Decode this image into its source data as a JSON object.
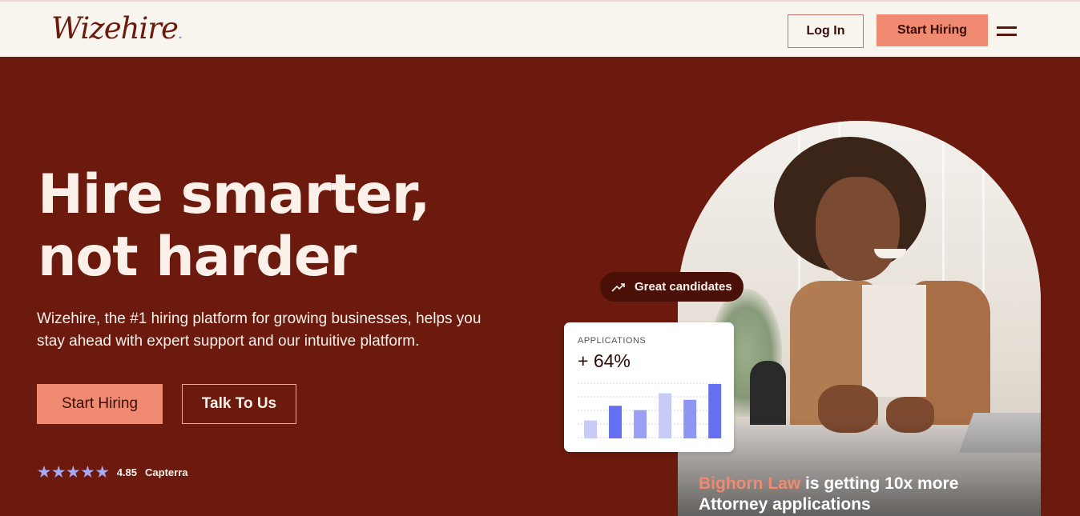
{
  "header": {
    "logo_text": "Wizehire",
    "logo_dot": ".",
    "login_label": "Log In",
    "start_hiring_label": "Start Hiring",
    "menu_icon": "hamburger-menu-icon"
  },
  "hero": {
    "title_line1": "Hire smarter,",
    "title_line2": "not harder",
    "subtitle": "Wizehire, the #1 hiring platform for growing businesses, helps you stay ahead with expert support and our intuitive platform.",
    "start_hiring_label": "Start Hiring",
    "talk_label": "Talk To Us",
    "rating": {
      "stars": 5,
      "score": "4.85",
      "source": "Capterra"
    }
  },
  "badge": {
    "icon": "trending-up-icon",
    "label": "Great candidates"
  },
  "card": {
    "label": "APPLICATIONS",
    "value": "+ 64%",
    "bars": [
      0.33,
      0.6,
      0.52,
      0.83,
      0.71,
      1.0
    ],
    "bar_colors": [
      "#c8caf8",
      "#6470f0",
      "#9aa0f4",
      "#c8caf8",
      "#8f95f2",
      "#6470f0"
    ]
  },
  "photo": {
    "caption_accent": "Bighorn Law",
    "caption_rest": " is getting 10x more Attorney applications"
  },
  "colors": {
    "brand_dark": "#6b1a0d",
    "accent": "#f08b72",
    "cream": "#f8f5ef",
    "chart_purple": "#6470f0"
  }
}
